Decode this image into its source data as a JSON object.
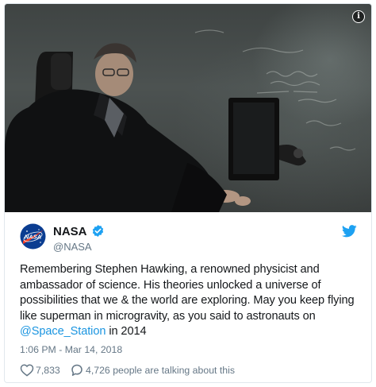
{
  "photo": {
    "info_icon": "info-icon"
  },
  "tweet": {
    "author_name": "NASA",
    "author_handle": "@NASA",
    "avatar": "nasa-logo-icon",
    "avatar_text": "NASA",
    "verified_icon": "verified-badge-icon",
    "platform_icon": "twitter-bird-icon",
    "text_lines": [
      "Remembering Stephen Hawking, a renowned physicist and",
      "ambassador of science. His theories unlocked a universe of",
      "possibilities that we & the world are exploring. May you keep flying",
      "like superman in microgravity, as you said to astronauts on"
    ],
    "mention": "@Space_Station",
    "text_tail": " in 2014",
    "timestamp": "1:06 PM - Mar 14, 2018",
    "like_count": "7,833",
    "talking_text": "4,726 people are talking about this"
  },
  "colors": {
    "link": "#1b95e0",
    "secondary_text": "#657786",
    "primary_text": "#14171a",
    "border": "#e1e8ed",
    "nasa_blue": "#0b3d91",
    "nasa_red": "#fc3d21",
    "twitter_blue": "#1da1f2"
  }
}
